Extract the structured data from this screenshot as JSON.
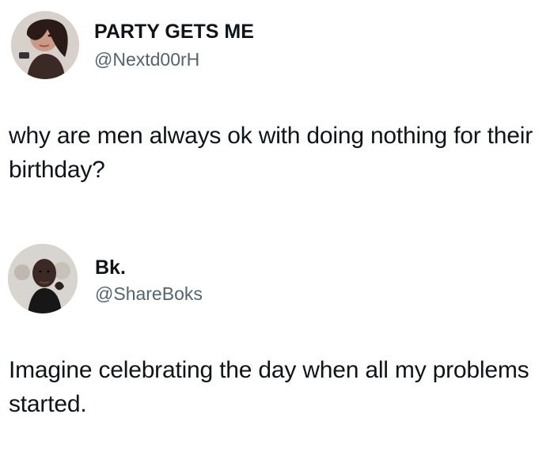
{
  "posts": [
    {
      "display_name": "PARTY GETS ME",
      "handle": "@Nextd00rH",
      "text": "why are men always ok with doing nothing for their birthday?",
      "avatar": "profile-photo"
    },
    {
      "display_name": "Bk.",
      "handle": "@ShareBoks",
      "text": "Imagine celebrating the day when all my problems started.",
      "avatar": "profile-photo"
    }
  ],
  "colors": {
    "text": "#0f1419",
    "handle": "#536471",
    "background": "#ffffff"
  }
}
